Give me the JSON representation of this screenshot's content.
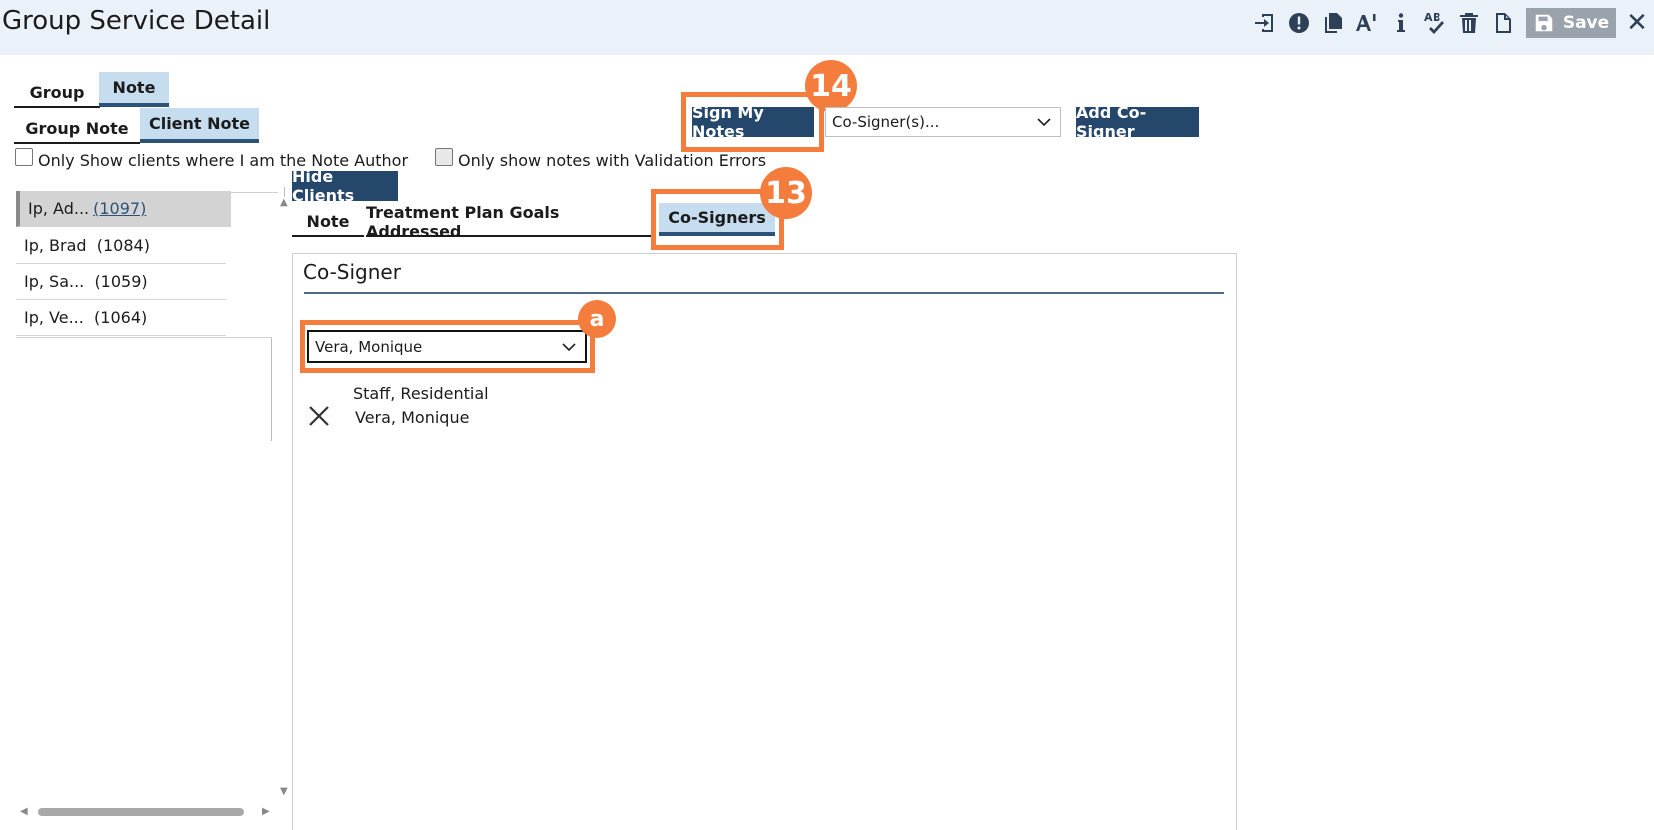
{
  "header": {
    "title": "Group Service Detail",
    "toolbar_icons": [
      "sign-in-icon",
      "alert-icon",
      "copy-icon",
      "font-size-icon",
      "info-icon",
      "spell-check-icon",
      "trash-icon",
      "document-icon"
    ],
    "save_label": "Save",
    "close_glyph": "✕"
  },
  "tabs_top": [
    {
      "label": "Group",
      "active": false
    },
    {
      "label": "Note",
      "active": true
    }
  ],
  "tabs_sub": [
    {
      "label": "Group Note",
      "active": false
    },
    {
      "label": "Client Note",
      "active": true
    }
  ],
  "filters": {
    "author_only": "Only Show clients where I am the Note Author",
    "validation_errors": "Only show notes with Validation Errors"
  },
  "actions": {
    "sign_notes": "Sign My Notes",
    "cosigner_select_placeholder": "Co-Signer(s)...",
    "add_cosigner": "Add Co-Signer",
    "hide_clients": "Hide Clients"
  },
  "clients": [
    {
      "name": "Ip, Ad...",
      "id": "(1097)",
      "selected": true
    },
    {
      "name": "Ip, Brad",
      "id": "(1084)",
      "selected": false
    },
    {
      "name": "Ip, Sa...",
      "id": "(1059)",
      "selected": false
    },
    {
      "name": "Ip, Ve...",
      "id": "(1064)",
      "selected": false
    }
  ],
  "note_tabs": [
    {
      "label": "Note",
      "active": false
    },
    {
      "label": "Treatment Plan Goals Addressed",
      "active": false
    },
    {
      "label": "Co-Signers",
      "active": true
    }
  ],
  "cosigner_panel": {
    "title": "Co-Signer",
    "selected_value": "Vera, Monique",
    "entry": {
      "role": "Staff, Residential",
      "name": "Vera, Monique"
    }
  },
  "annotations": {
    "step_14": "14",
    "step_13": "13",
    "step_a": "a",
    "accent_color": "#f47c3c"
  }
}
